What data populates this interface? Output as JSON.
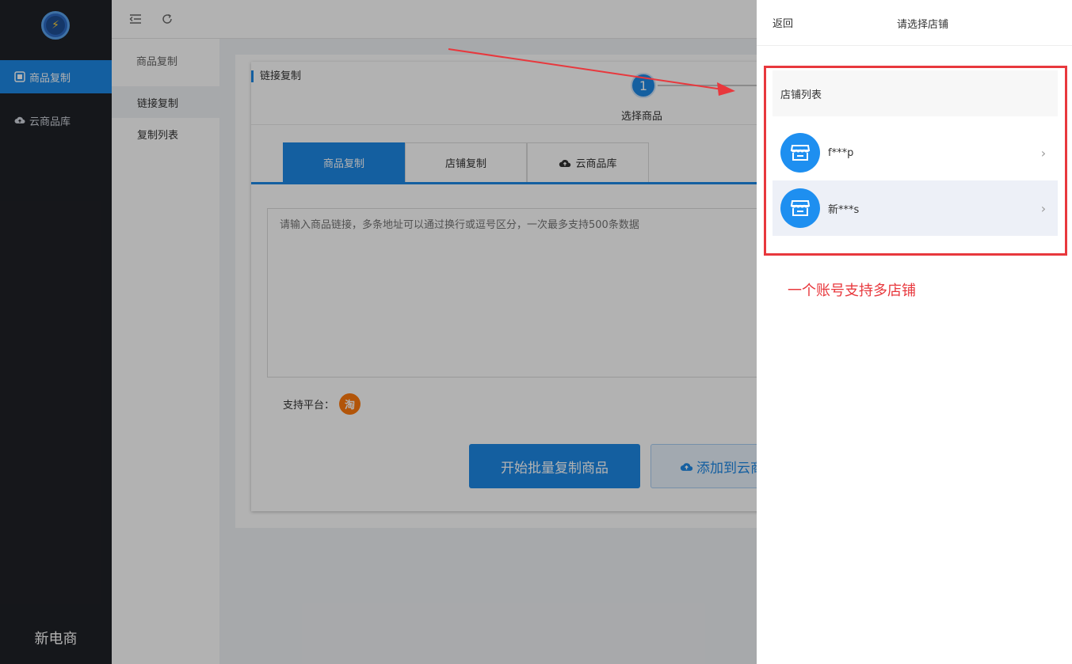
{
  "sidebar": {
    "brand": "新电商",
    "items": [
      {
        "label": "商品复制",
        "icon": "copy-icon"
      },
      {
        "label": "云商品库",
        "icon": "cloud-icon"
      }
    ]
  },
  "submenu": {
    "group": "商品复制",
    "items": [
      {
        "label": "链接复制"
      },
      {
        "label": "复制列表"
      }
    ]
  },
  "topbar": {
    "icons": [
      "collapse-menu-icon",
      "refresh-icon"
    ]
  },
  "main": {
    "section_title": "链接复制",
    "step": {
      "number": "1",
      "label": "选择商品"
    },
    "tabs": [
      {
        "label": "商品复制"
      },
      {
        "label": "店铺复制"
      },
      {
        "label": "云商品库",
        "icon": "cloud-upload-icon"
      }
    ],
    "textarea_placeholder": "请输入商品链接，多条地址可以通过换行或逗号区分，一次最多支持500条数据",
    "platform_label": "支持平台：",
    "platform_badge": "淘",
    "start_button": "开始批量复制商品",
    "cloud_button": "添加到云商品库"
  },
  "drawer": {
    "back": "返回",
    "title": "请选择店铺",
    "list_header": "店铺列表",
    "stores": [
      {
        "name": "f***p"
      },
      {
        "name": "新***s"
      }
    ],
    "note": "一个账号支持多店铺"
  },
  "colors": {
    "primary": "#1e88e5",
    "sidebar_bg": "#1f2127",
    "annotation_red": "#e8383d"
  }
}
